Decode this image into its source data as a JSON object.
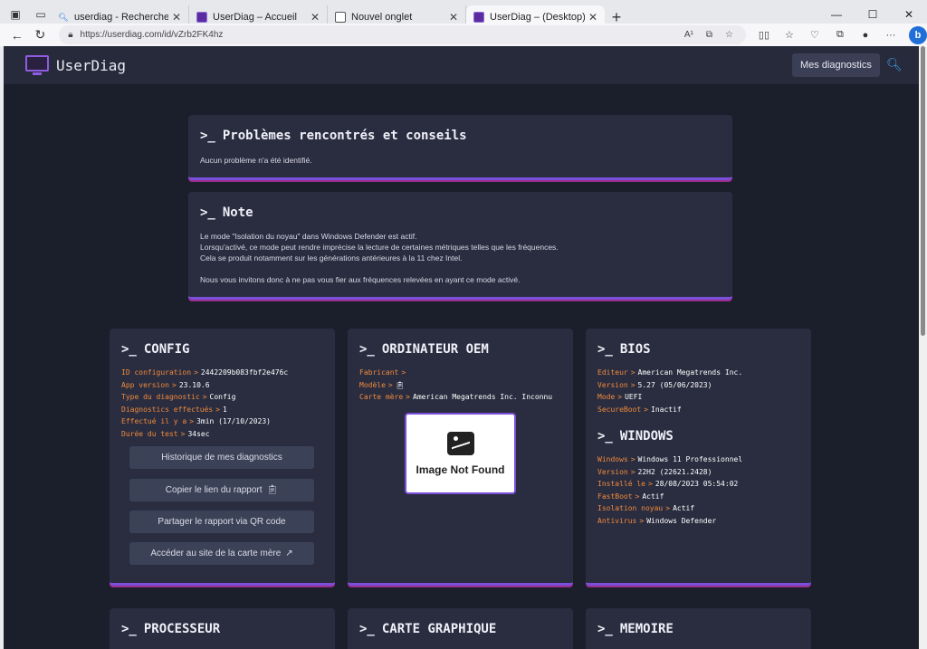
{
  "browser": {
    "tabs": [
      {
        "title": "userdiag - Recherche",
        "favicon": "search-icon",
        "active": false
      },
      {
        "title": "UserDiag – Accueil",
        "favicon": "userdiag-favicon",
        "active": false
      },
      {
        "title": "Nouvel onglet",
        "favicon": "newtab-favicon",
        "active": false
      },
      {
        "title": "UserDiag – (Desktop)",
        "favicon": "userdiag-favicon",
        "active": true
      }
    ],
    "url": "https://userdiag.com/id/vZrb2FK4hz",
    "read_aloud": "A¹"
  },
  "header": {
    "brand": "UserDiag",
    "my_diagnostics": "Mes diagnostics"
  },
  "problems": {
    "prompt": ">_",
    "title": "Problèmes rencontrés et conseils",
    "text": "Aucun problème n'a été identifié."
  },
  "note": {
    "prompt": ">_",
    "title": "Note",
    "line1": "Le mode \"Isolation du noyau\" dans Windows Defender est actif.",
    "line2": "Lorsqu'activé, ce mode peut rendre imprécise la lecture de certaines métriques telles que les fréquences.",
    "line3": "Cela se produit notamment sur les générations antérieures à la 11 chez Intel.",
    "line4": "Nous vous invitons donc à ne pas vous fier aux fréquences relevées en ayant ce mode activé."
  },
  "config": {
    "prompt": ">_",
    "title": "CONFIG",
    "rows": [
      {
        "k": "ID configuration",
        "v": "2442209b083fbf2e476c"
      },
      {
        "k": "App version",
        "v": "23.10.6"
      },
      {
        "k": "Type du diagnostic",
        "v": "Config"
      },
      {
        "k": "Diagnostics effectués",
        "v": "1"
      },
      {
        "k": "Effectué il y a",
        "v": "3min (17/10/2023)"
      },
      {
        "k": "Durée du test",
        "v": "34sec"
      }
    ],
    "buttons": {
      "history": "Historique de mes diagnostics",
      "copy_link": "Copier le lien du rapport",
      "share_qr": "Partager le rapport via QR code",
      "motherboard_site": "Accéder au site de la carte mère"
    }
  },
  "oem": {
    "prompt": ">_",
    "title": "ORDINATEUR OEM",
    "rows": [
      {
        "k": "Fabricant",
        "v": ""
      },
      {
        "k": "Modèle",
        "v": ""
      },
      {
        "k": "Carte mère",
        "v": "American Megatrends Inc. Inconnu"
      }
    ],
    "image_caption": "Image Not Found"
  },
  "bios": {
    "prompt": ">_",
    "title": "BIOS",
    "rows": [
      {
        "k": "Editeur",
        "v": "American Megatrends Inc."
      },
      {
        "k": "Version",
        "v": "5.27 (05/06/2023)"
      },
      {
        "k": "Mode",
        "v": "UEFI"
      },
      {
        "k": "SecureBoot",
        "v": "Inactif"
      }
    ]
  },
  "windows": {
    "prompt": ">_",
    "title": "WINDOWS",
    "rows": [
      {
        "k": "Windows",
        "v": "Windows 11 Professionnel"
      },
      {
        "k": "Version",
        "v": "22H2 (22621.2428)"
      },
      {
        "k": "Installé le",
        "v": "28/08/2023 05:54:02"
      },
      {
        "k": "FastBoot",
        "v": "Actif"
      },
      {
        "k": "Isolation noyau",
        "v": "Actif"
      },
      {
        "k": "Antivirus",
        "v": "Windows Defender"
      }
    ]
  },
  "bottom_cards": {
    "prompt": ">_",
    "cpu": "PROCESSEUR",
    "gpu": "CARTE GRAPHIQUE",
    "ram": "MEMOIRE"
  },
  "colors": {
    "page_bg": "#1b1e2b",
    "card_bg": "#2a2d40",
    "accent_purple": "#7a4fd9",
    "key_orange": "#f08a3c"
  }
}
